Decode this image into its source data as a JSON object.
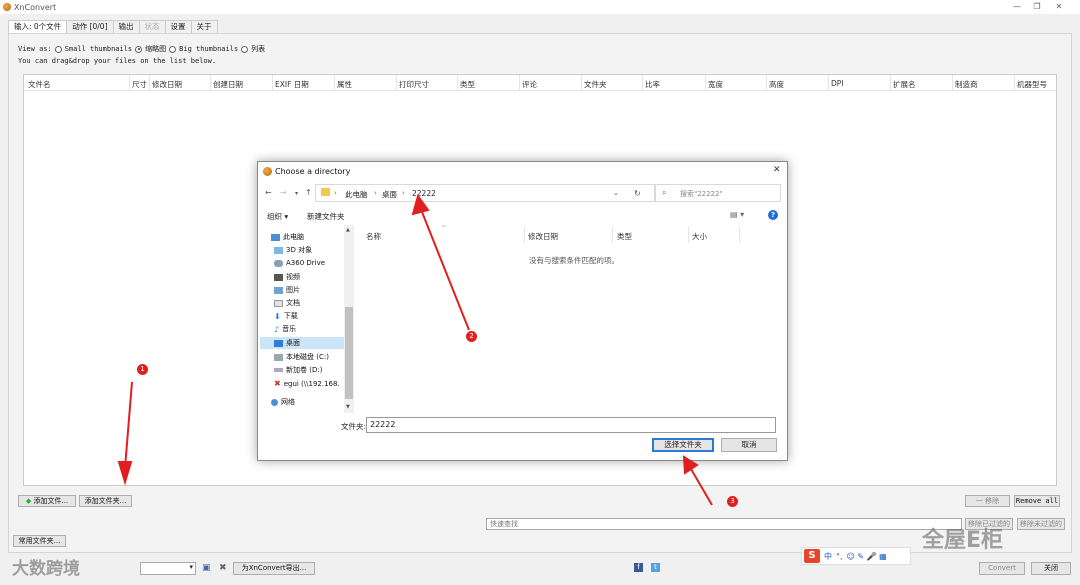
{
  "window": {
    "title": "XnConvert",
    "min": "—",
    "restore": "❐",
    "close": "✕"
  },
  "tabs": [
    {
      "label": "输入: 0个文件"
    },
    {
      "label": "动作 [0/0]"
    },
    {
      "label": "输出"
    },
    {
      "label": "状态"
    },
    {
      "label": "设置"
    },
    {
      "label": "关于"
    }
  ],
  "view": {
    "label": "View as:",
    "opt1": "Small thumbnails",
    "opt2": "缩略图",
    "opt3": "Big thumbnails",
    "opt4": "列表",
    "hint": "You can drag&drop your files on the list below."
  },
  "columns": [
    "文件名",
    "尺寸",
    "修改日期",
    "创建日期",
    "EXIF 日期",
    "属性",
    "打印尺寸",
    "类型",
    "评论",
    "文件夹",
    "比率",
    "宽度",
    "高度",
    "DPI",
    "扩展名",
    "制造商",
    "机器型号"
  ],
  "buttons": {
    "add_files": "添加文件...",
    "add_folder": "添加文件夹...",
    "remove": "一 移除",
    "remove_all": "Remove all",
    "common_folder": "常用文件夹...",
    "export": "为XnConvert导出...",
    "convert": "Convert",
    "close": "关闭",
    "filter_a": "移除已过滤的",
    "filter_b": "移除未过滤的"
  },
  "quick_search": {
    "placeholder": "快速查找"
  },
  "dialog": {
    "title": "Choose a directory",
    "path": [
      "此电脑",
      "桌面",
      "22222"
    ],
    "search_placeholder": "搜索\"22222\"",
    "organize": "组织 ▾",
    "new_folder": "新建文件夹",
    "tree": [
      "此电脑",
      "3D 对象",
      "A360 Drive",
      "视频",
      "图片",
      "文档",
      "下载",
      "音乐",
      "桌面",
      "本地磁盘 (C:)",
      "新加卷 (D:)",
      "egui (\\\\192.168.",
      "网络"
    ],
    "columns": [
      "名称",
      "修改日期",
      "类型",
      "大小"
    ],
    "empty": "没有与搜索条件匹配的项。",
    "folder_label": "文件夹:",
    "folder_value": "22222",
    "select_btn": "选择文件夹",
    "cancel_btn": "取消"
  },
  "markers": [
    "1",
    "2",
    "3"
  ],
  "watermarks": {
    "left": "大数跨境",
    "right": "全屋E柜"
  },
  "ime": {
    "s": "S",
    "lang": "中",
    "sym": "°,",
    "icons": "☺ ✎ 🎤 ▦"
  },
  "colors": {
    "marker": "#e02020",
    "accent": "#2a7ad5"
  }
}
